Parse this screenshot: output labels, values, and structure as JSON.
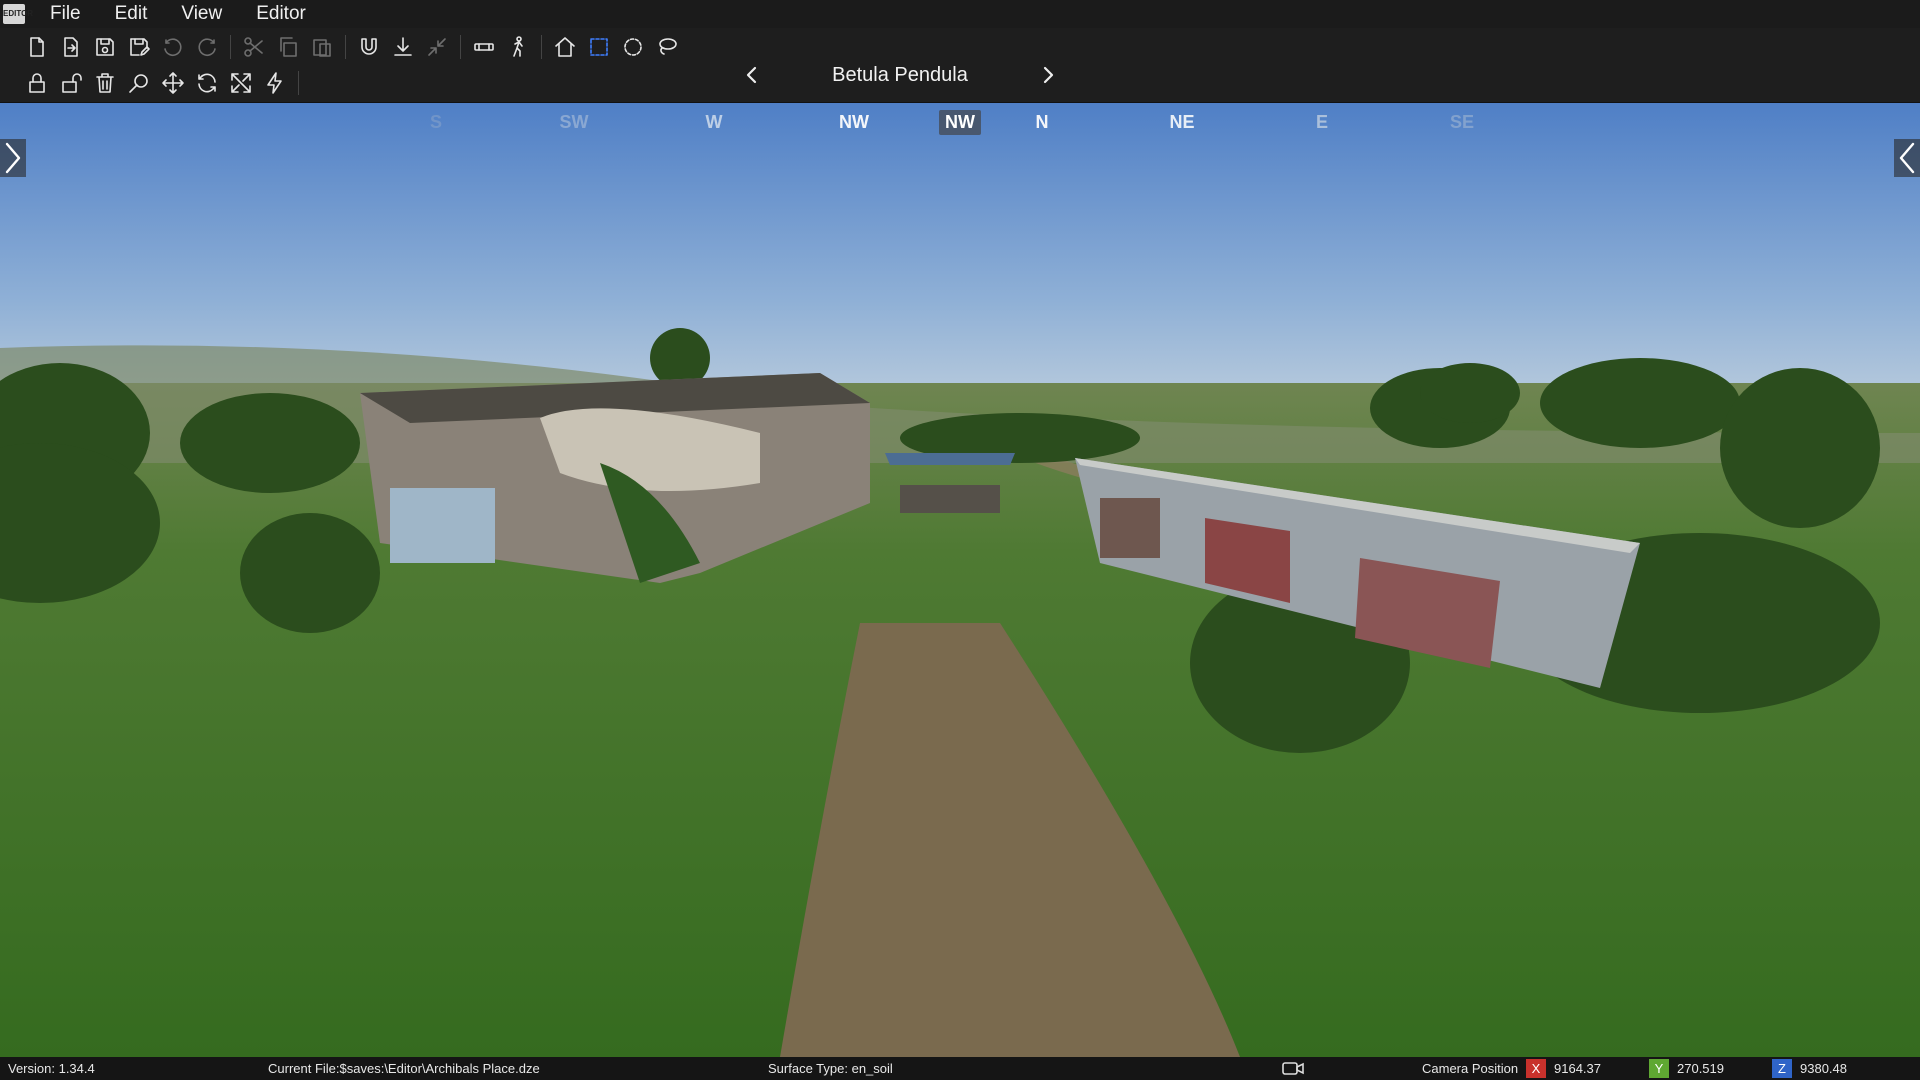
{
  "app": {
    "logo_text": "EDITOR"
  },
  "menu": {
    "items": [
      "File",
      "Edit",
      "View",
      "Editor"
    ]
  },
  "toolbar": {
    "row1": [
      {
        "icon": "new-file-icon",
        "state": "normal"
      },
      {
        "icon": "open-file-icon",
        "state": "normal"
      },
      {
        "icon": "save-icon",
        "state": "normal"
      },
      {
        "icon": "save-as-icon",
        "state": "normal"
      },
      {
        "icon": "undo-icon",
        "state": "disabled"
      },
      {
        "icon": "redo-icon",
        "state": "disabled"
      },
      {
        "icon": "cut-icon",
        "state": "disabled"
      },
      {
        "icon": "copy-icon",
        "state": "disabled"
      },
      {
        "icon": "paste-icon",
        "state": "disabled"
      },
      {
        "icon": "magnet-icon",
        "state": "normal"
      },
      {
        "icon": "ground-snap-icon",
        "state": "normal"
      },
      {
        "icon": "collapse-icon",
        "state": "disabled"
      },
      {
        "icon": "binoculars-icon",
        "state": "normal"
      },
      {
        "icon": "walk-icon",
        "state": "normal"
      },
      {
        "icon": "home-icon",
        "state": "normal"
      },
      {
        "icon": "box-select-icon",
        "state": "active"
      },
      {
        "icon": "circle-select-icon",
        "state": "normal"
      },
      {
        "icon": "lasso-select-icon",
        "state": "normal"
      }
    ],
    "row2": [
      {
        "icon": "lock-icon",
        "state": "normal"
      },
      {
        "icon": "unlock-icon",
        "state": "normal"
      },
      {
        "icon": "trash-icon",
        "state": "normal"
      },
      {
        "icon": "magnify-icon",
        "state": "normal"
      },
      {
        "icon": "move-icon",
        "state": "normal"
      },
      {
        "icon": "rotate-icon",
        "state": "normal"
      },
      {
        "icon": "scale-icon",
        "state": "normal"
      },
      {
        "icon": "lightning-icon",
        "state": "normal"
      }
    ]
  },
  "asset_nav": {
    "title": "Betula Pendula",
    "prev_icon": "chevron-left-icon",
    "next_icon": "chevron-right-icon"
  },
  "compass": [
    {
      "label": "S",
      "active": false
    },
    {
      "label": "SW",
      "active": false
    },
    {
      "label": "W",
      "active": false
    },
    {
      "label": "NW",
      "active": false
    },
    {
      "label": "NW",
      "active": true
    },
    {
      "label": "N",
      "active": false
    },
    {
      "label": "NE",
      "active": false
    },
    {
      "label": "E",
      "active": false
    },
    {
      "label": "SE",
      "active": false
    }
  ],
  "status": {
    "version": "Version: 1.34.4",
    "current_file": "Current File:$saves:\\Editor\\Archibals Place.dze",
    "surface": "Surface Type: en_soil",
    "camera_label": "Camera Position",
    "x_label": "X",
    "x_value": "9164.37",
    "y_label": "Y",
    "y_value": "270.519",
    "z_label": "Z",
    "z_value": "9380.48",
    "x_color": "#c8312c",
    "y_color": "#5fa832",
    "z_color": "#2f64c8"
  }
}
